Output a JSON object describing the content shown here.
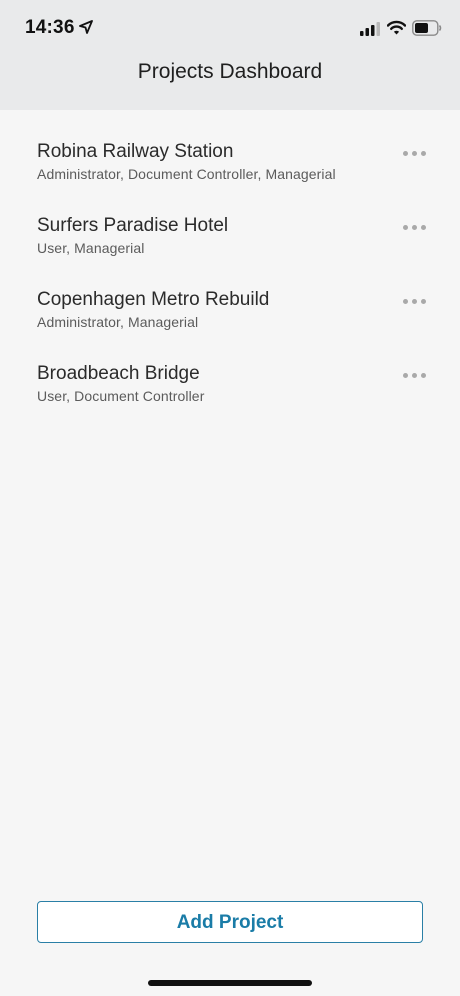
{
  "status_bar": {
    "time": "14:36",
    "location_icon": "location-arrow-icon",
    "signal_icon": "cellular-signal-icon",
    "wifi_icon": "wifi-icon",
    "battery_icon": "battery-icon"
  },
  "header": {
    "title": "Projects Dashboard"
  },
  "projects": [
    {
      "name": "Robina Railway Station",
      "roles": "Administrator, Document Controller, Managerial"
    },
    {
      "name": "Surfers Paradise Hotel",
      "roles": "User, Managerial"
    },
    {
      "name": "Copenhagen Metro Rebuild",
      "roles": "Administrator, Managerial"
    },
    {
      "name": "Broadbeach Bridge",
      "roles": "User, Document Controller"
    }
  ],
  "footer": {
    "add_project_label": "Add Project"
  },
  "colors": {
    "accent": "#1a7ca7",
    "header_bg": "#e9eaeb",
    "page_bg": "#f6f6f6"
  }
}
